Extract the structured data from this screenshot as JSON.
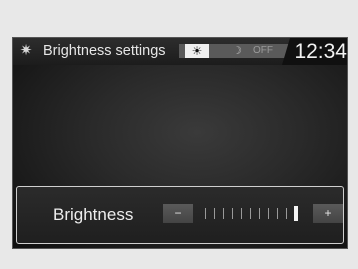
{
  "header": {
    "icon": "gear-icon",
    "title": "Brightness settings",
    "mode_day": "☀",
    "mode_night": "☽",
    "mode_off": "OFF",
    "selected_mode": "day",
    "time": "12:34"
  },
  "brightness": {
    "label": "Brightness",
    "minus_label": "−",
    "plus_label": "+",
    "level": 10,
    "max": 11
  }
}
